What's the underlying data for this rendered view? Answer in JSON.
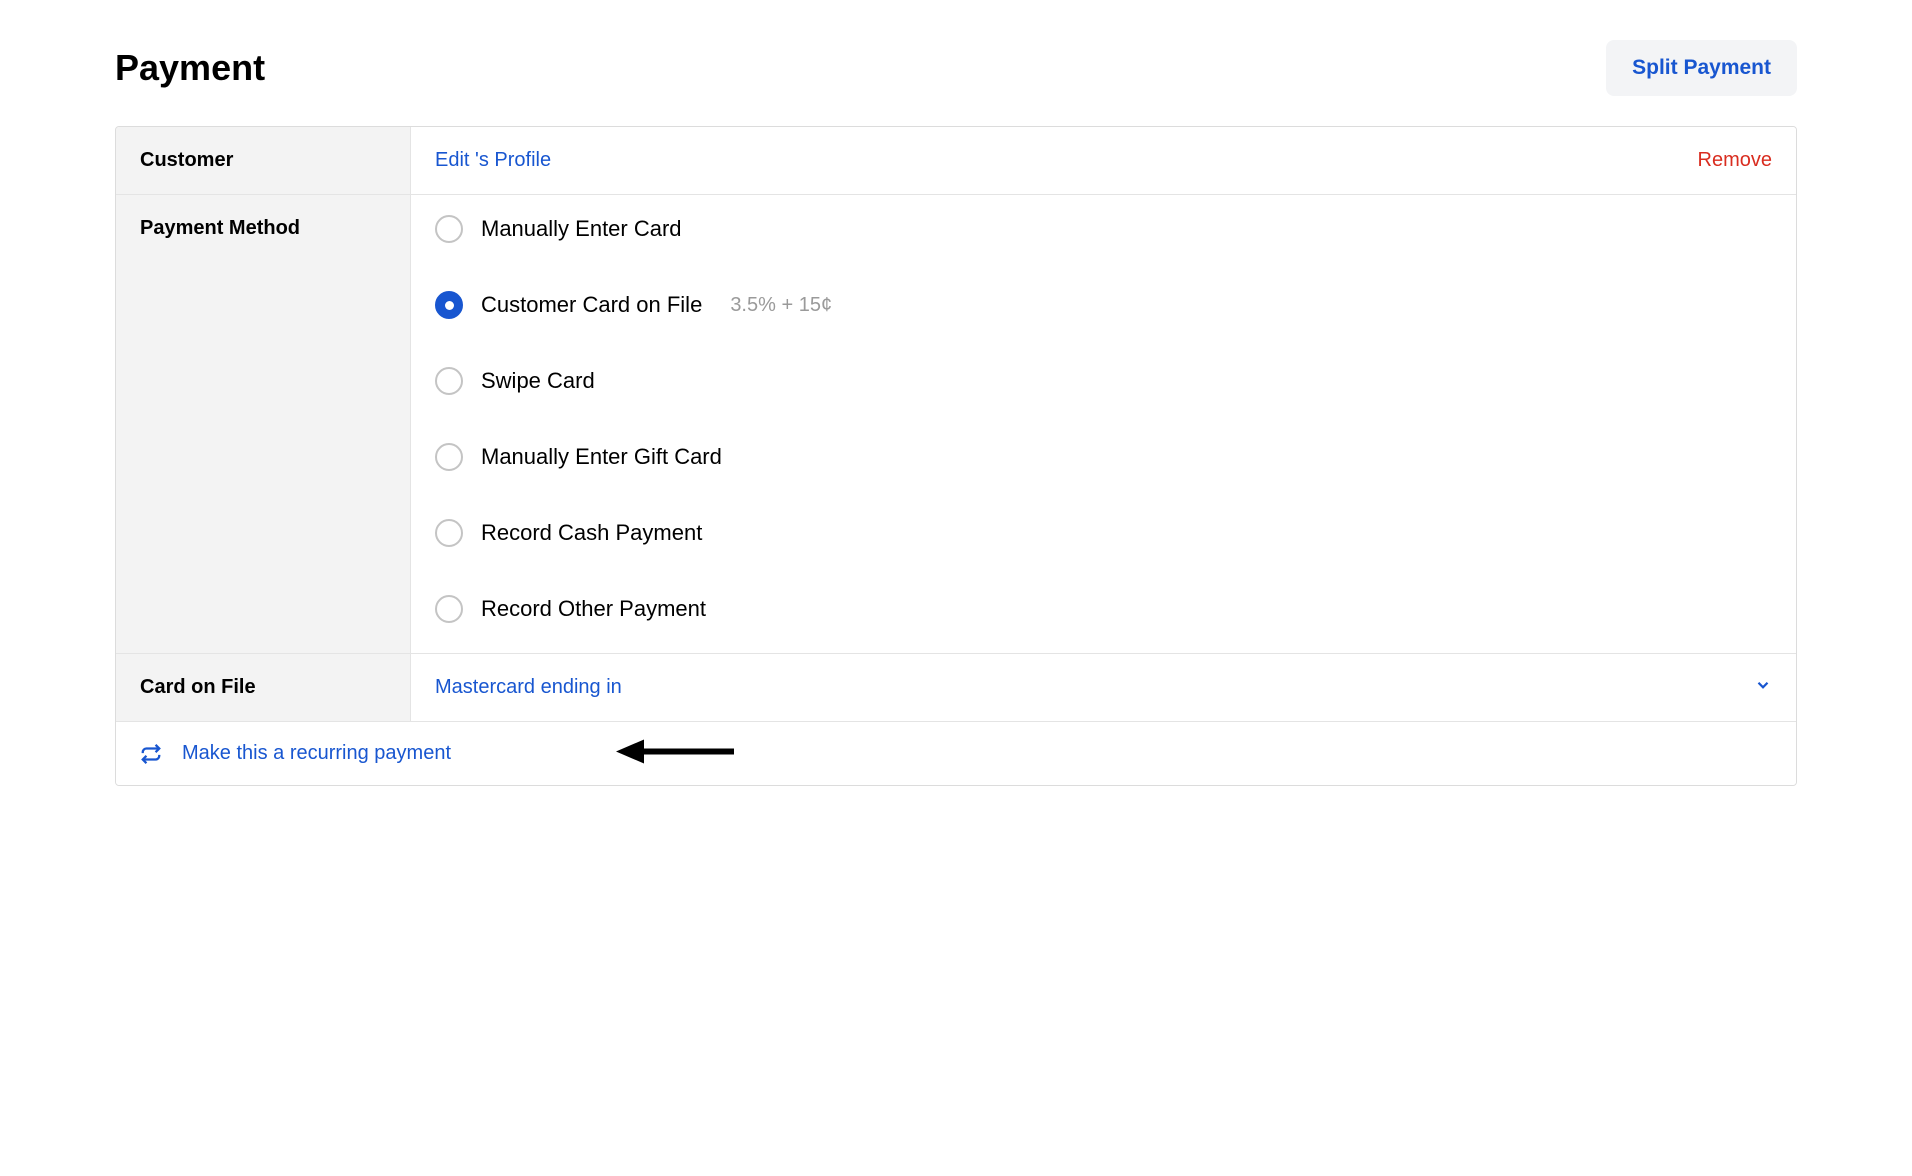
{
  "header": {
    "title": "Payment",
    "split_button_label": "Split Payment"
  },
  "customer": {
    "section_label": "Customer",
    "edit_profile_label": "Edit 's Profile",
    "remove_label": "Remove"
  },
  "payment_method": {
    "section_label": "Payment Method",
    "options": [
      {
        "label": "Manually Enter Card",
        "selected": false,
        "fee": ""
      },
      {
        "label": "Customer Card on File",
        "selected": true,
        "fee": "3.5% + 15¢"
      },
      {
        "label": "Swipe Card",
        "selected": false,
        "fee": ""
      },
      {
        "label": "Manually Enter Gift Card",
        "selected": false,
        "fee": ""
      },
      {
        "label": "Record Cash Payment",
        "selected": false,
        "fee": ""
      },
      {
        "label": "Record Other Payment",
        "selected": false,
        "fee": ""
      }
    ]
  },
  "card_on_file": {
    "section_label": "Card on File",
    "value": "Mastercard ending in"
  },
  "recurring": {
    "label": "Make this a recurring payment"
  }
}
